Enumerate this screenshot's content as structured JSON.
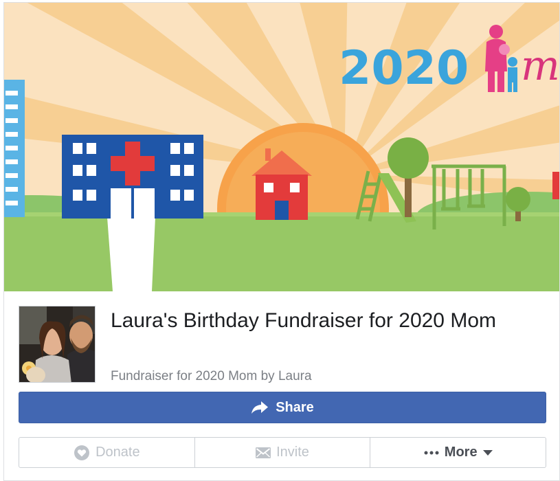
{
  "cover": {
    "brand_year": "2020",
    "brand_suffix": "m"
  },
  "fundraiser": {
    "title": "Laura's Birthday Fundraiser for 2020 Mom",
    "subtitle": "Fundraiser for 2020 Mom by Laura"
  },
  "actions": {
    "share_label": "Share",
    "donate_label": "Donate",
    "invite_label": "Invite",
    "more_label": "More"
  },
  "colors": {
    "primary_blue": "#4267b2",
    "brand_blue": "#3aa4dc",
    "brand_pink": "#d8347c",
    "disabled_gray": "#bec3c9"
  }
}
